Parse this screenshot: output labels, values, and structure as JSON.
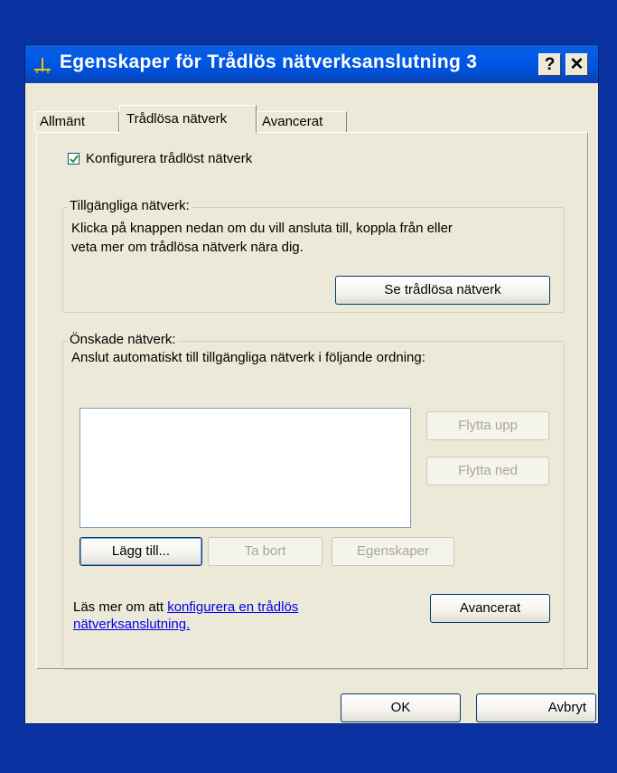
{
  "window": {
    "title": "Egenskaper för Trådlös nätverksanslutning 3",
    "help_button": "?",
    "close_button": "✕"
  },
  "tabs": [
    {
      "label": "Allmänt",
      "active": false
    },
    {
      "label": "Trådlösa nätverk",
      "active": true
    },
    {
      "label": "Avancerat",
      "active": false
    }
  ],
  "config": {
    "checkbox_label": "Konfigurera trådlöst nätverk",
    "checked": true
  },
  "available": {
    "group_title": "Tillgängliga nätverk:",
    "description_line1": "Klicka på knappen nedan om du vill ansluta till, koppla från eller",
    "description_line2": "veta mer om trådlösa nätverk nära dig.",
    "view_button": "Se trådlösa nätverk"
  },
  "preferred": {
    "group_title": "Önskade nätverk:",
    "description": "Anslut automatiskt till tillgängliga nätverk i följande ordning:",
    "list_items": [],
    "move_up_button": "Flytta upp",
    "move_down_button": "Flytta ned",
    "add_button": "Lägg till...",
    "remove_button": "Ta bort",
    "properties_button": "Egenskaper",
    "learn_prefix": "Läs mer om att ",
    "learn_link_line1": "konfigurera en trådlös",
    "learn_link_line2": "nätverksanslutning.",
    "advanced_button": "Avancerat"
  },
  "footer": {
    "ok_button": "OK",
    "cancel_button": "Avbryt"
  }
}
